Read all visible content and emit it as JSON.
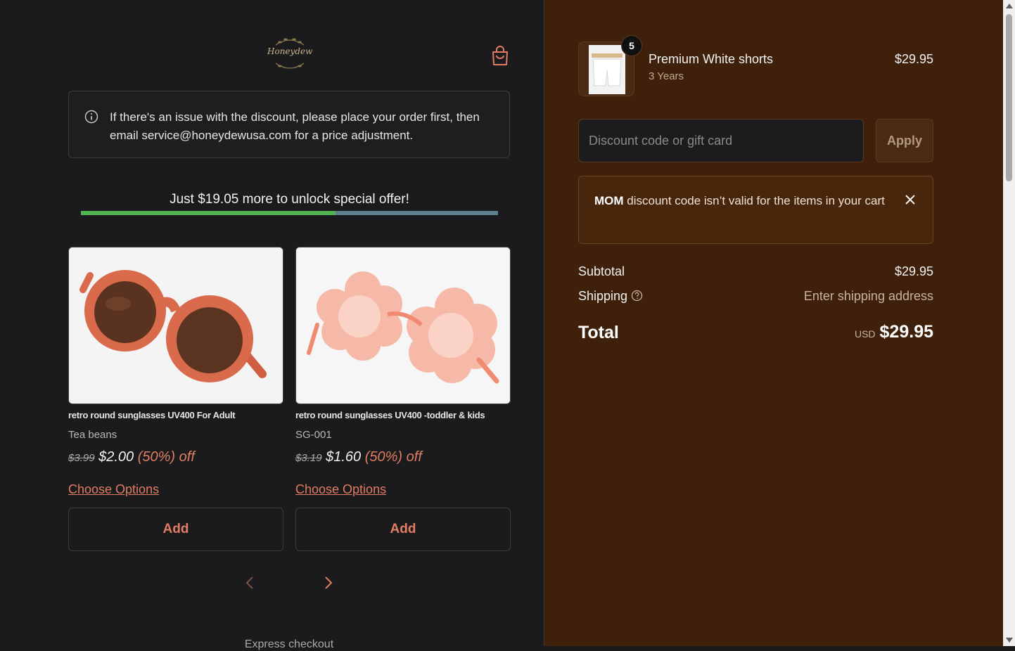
{
  "brand": {
    "logo_text": "Honeydew"
  },
  "notice": {
    "text": "If there's an issue with the discount, please place your order first, then email service@honeydewusa.com for a price adjustment."
  },
  "offer": {
    "text": "Just $19.05 more to unlock special offer!",
    "progress_fraction": 0.61
  },
  "upsell": [
    {
      "title": "retro round sunglasses UV400 For Adult",
      "variant": "Tea beans",
      "old_price": "$3.99",
      "new_price": "$2.00",
      "discount": "(50%) off",
      "choose_label": "Choose Options",
      "add_label": "Add"
    },
    {
      "title": "retro round sunglasses UV400 -toddler & kids",
      "variant": "SG-001",
      "old_price": "$3.19",
      "new_price": "$1.60",
      "discount": "(50%) off",
      "choose_label": "Choose Options",
      "add_label": "Add"
    }
  ],
  "express": {
    "label": "Express checkout"
  },
  "cart": {
    "item": {
      "name": "Premium White shorts",
      "variant": "3 Years",
      "price": "$29.95",
      "quantity": "5"
    },
    "discount": {
      "placeholder": "Discount code or gift card",
      "apply_label": "Apply"
    },
    "error": {
      "code": "MOM",
      "message": " discount code isn’t valid for the items in your cart"
    },
    "subtotal": {
      "label": "Subtotal",
      "value": "$29.95"
    },
    "shipping": {
      "label": "Shipping",
      "value": "Enter shipping address"
    },
    "total": {
      "label": "Total",
      "currency": "USD",
      "value": "$29.95"
    }
  },
  "colors": {
    "accent": "#e07d62",
    "progress_fill": "#52b552",
    "progress_track": "#5c7f8e",
    "right_bg": "#3f210b"
  }
}
